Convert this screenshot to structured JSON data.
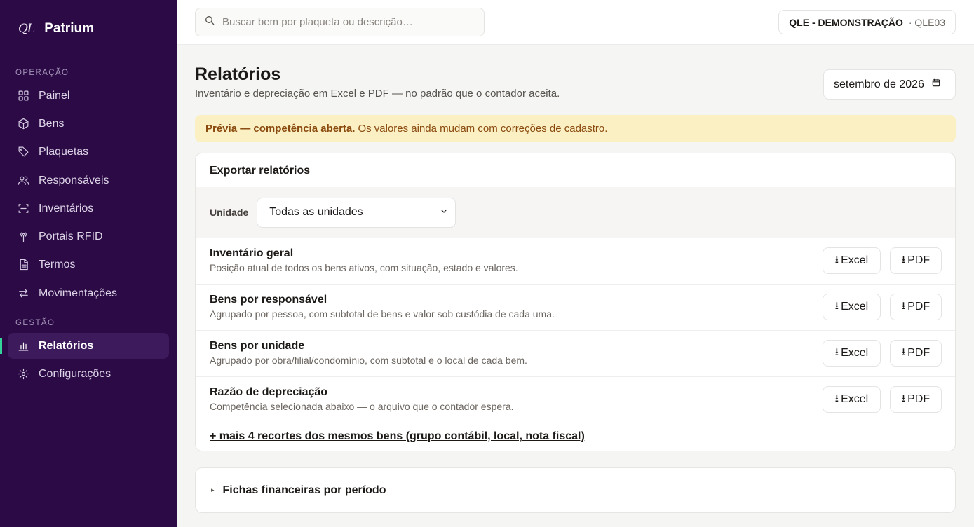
{
  "brand": {
    "mark": "QL",
    "name": "Patrium"
  },
  "sidebar": {
    "section_operation": "OPERAÇÃO",
    "section_management": "GESTÃO",
    "items": [
      {
        "label": "Painel",
        "icon": "grid-icon"
      },
      {
        "label": "Bens",
        "icon": "box-icon"
      },
      {
        "label": "Plaquetas",
        "icon": "tag-icon"
      },
      {
        "label": "Responsáveis",
        "icon": "users-icon"
      },
      {
        "label": "Inventários",
        "icon": "scan-icon"
      },
      {
        "label": "Portais RFID",
        "icon": "antenna-icon"
      },
      {
        "label": "Termos",
        "icon": "document-icon"
      },
      {
        "label": "Movimentações",
        "icon": "arrows-icon"
      },
      {
        "label": "Relatórios",
        "icon": "bar-chart-icon",
        "active": true
      },
      {
        "label": "Configurações",
        "icon": "gear-icon"
      }
    ],
    "active_color": "#34d399"
  },
  "topbar": {
    "search_placeholder": "Buscar bem por plaqueta ou descrição…",
    "tenant_name": "QLE - DEMONSTRAÇÃO",
    "tenant_code": "· QLE03"
  },
  "page": {
    "title": "Relatórios",
    "subtitle": "Inventário e depreciação em Excel e PDF — no padrão que o contador aceita.",
    "period": "setembro de 2026"
  },
  "banner": {
    "strong": "Prévia — competência aberta.",
    "text": "Os valores ainda mudam com correções de cadastro.",
    "bg_color": "#fbf0c4"
  },
  "export": {
    "title": "Exportar relatórios",
    "filter_label": "Unidade",
    "unit_selected": "Todas as unidades",
    "excel_label": "Excel",
    "pdf_label": "PDF",
    "download_glyph": "⭳",
    "reports": [
      {
        "title": "Inventário geral",
        "desc": "Posição atual de todos os bens ativos, com situação, estado e valores."
      },
      {
        "title": "Bens por responsável",
        "desc": "Agrupado por pessoa, com subtotal de bens e valor sob custódia de cada uma."
      },
      {
        "title": "Bens por unidade",
        "desc": "Agrupado por obra/filial/condomínio, com subtotal e o local de cada bem."
      },
      {
        "title": "Razão de depreciação",
        "desc": "Competência selecionada abaixo — o arquivo que o contador espera."
      }
    ],
    "more_link": "+ mais 4 recortes dos mesmos bens (grupo contábil, local, nota fiscal)"
  },
  "financial": {
    "title": "Fichas financeiras por período"
  }
}
